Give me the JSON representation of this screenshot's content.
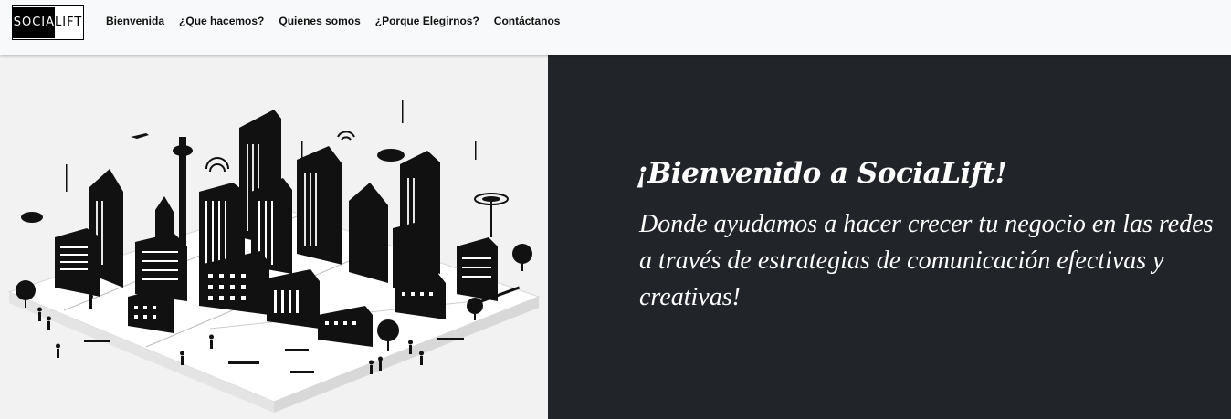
{
  "header": {
    "logo": {
      "part_dark": "SOCIA",
      "part_light": "LIFT"
    },
    "nav": [
      {
        "label": "Bienvenida"
      },
      {
        "label": "¿Que hacemos?"
      },
      {
        "label": "Quienes somos"
      },
      {
        "label": "¿Porque Elegirnos?"
      },
      {
        "label": "Contáctanos"
      }
    ]
  },
  "hero": {
    "image_icon": "city-illustration",
    "title": "¡Bienvenido a SociaLift!",
    "subtitle": "Donde ayudamos a hacer crecer tu negocio en las redes a través de estrategias de comunicación efectivas y creativas!"
  },
  "colors": {
    "navbar_bg": "#f8f9fa",
    "panel_bg": "#212529",
    "text_light": "#ffffff",
    "text_dark": "#111111"
  }
}
